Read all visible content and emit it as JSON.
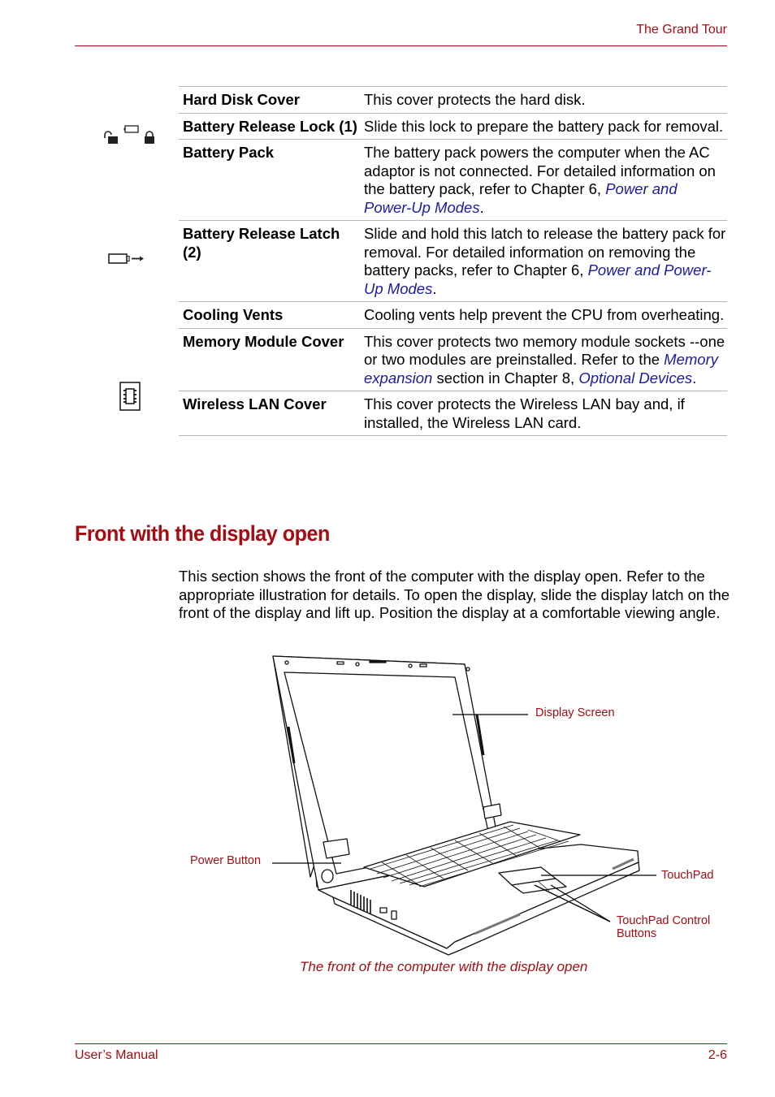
{
  "header": {
    "title": "The Grand Tour"
  },
  "table": {
    "rows": [
      {
        "term": "Hard Disk Cover",
        "desc_parts": [
          {
            "text": "This cover protects the hard disk.",
            "link": false
          }
        ]
      },
      {
        "term": "Battery Release Lock (1)",
        "icon": "battery-lock-icon",
        "desc_parts": [
          {
            "text": "Slide this lock to prepare the battery pack for removal.",
            "link": false
          }
        ]
      },
      {
        "term": "Battery Pack",
        "desc_parts": [
          {
            "text": "The battery pack powers the computer when the AC adaptor is not connected. For detailed information on the battery pack, refer to Chapter 6, ",
            "link": false
          },
          {
            "text": "Power and Power-Up Modes",
            "link": true
          },
          {
            "text": ".",
            "link": false
          }
        ]
      },
      {
        "term": "Battery Release Latch (2)",
        "icon": "battery-release-latch-icon",
        "desc_parts": [
          {
            "text": "Slide and hold this latch to release the battery pack for removal. For detailed information on removing the battery packs, refer to Chapter 6, ",
            "link": false
          },
          {
            "text": "Power and Power-Up Modes",
            "link": true
          },
          {
            "text": ".",
            "link": false
          }
        ]
      },
      {
        "term": "Cooling Vents",
        "desc_parts": [
          {
            "text": "Cooling vents help prevent the CPU from overheating.",
            "link": false
          }
        ]
      },
      {
        "term": "Memory Module Cover",
        "icon": "memory-module-icon",
        "desc_parts": [
          {
            "text": "This cover protects two memory module sockets --one or two modules are preinstalled. Refer to the ",
            "link": false
          },
          {
            "text": "Memory expansion",
            "link": true
          },
          {
            "text": " section in Chapter 8, ",
            "link": false
          },
          {
            "text": "Optional Devices",
            "link": true
          },
          {
            "text": ".",
            "link": false
          }
        ]
      },
      {
        "term": "Wireless LAN Cover",
        "desc_parts": [
          {
            "text": "This cover protects the Wireless LAN bay and, if installed, the Wireless LAN card.",
            "link": false
          }
        ]
      }
    ]
  },
  "section": {
    "heading": "Front with the display open",
    "body": "This section shows the front of the computer with the display open. Refer to the appropriate illustration for details. To open the display, slide the display latch on the front of the display and lift up. Position the display at a comfortable viewing angle."
  },
  "figure": {
    "callouts": {
      "display_screen": "Display Screen",
      "power_button": "Power Button",
      "touchpad": "TouchPad",
      "touchpad_buttons_line1": "TouchPad Control",
      "touchpad_buttons_line2": "Buttons"
    },
    "caption": "The front of the computer with the display open"
  },
  "footer": {
    "left": "User’s Manual",
    "right": "2-6"
  },
  "colors": {
    "accent": "#a50d12",
    "link": "#1a1aa6",
    "rule": "#b8b8b8"
  }
}
